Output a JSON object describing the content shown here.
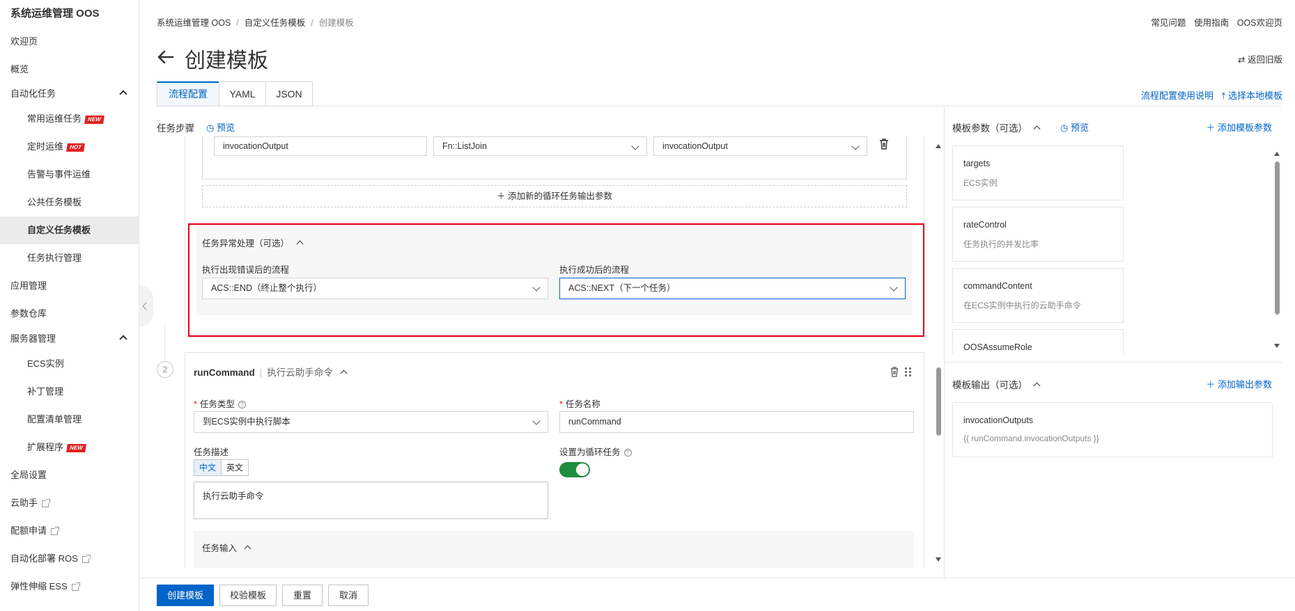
{
  "sidebar": {
    "title": "系统运维管理 OOS",
    "items": [
      {
        "label": "欢迎页"
      },
      {
        "label": "概览"
      },
      {
        "label": "自动化任务"
      },
      {
        "label": "常用运维任务",
        "badge": "NEW"
      },
      {
        "label": "定时运维",
        "badge": "HOT"
      },
      {
        "label": "告警与事件运维"
      },
      {
        "label": "公共任务模板"
      },
      {
        "label": "自定义任务模板"
      },
      {
        "label": "任务执行管理"
      },
      {
        "label": "应用管理"
      },
      {
        "label": "参数仓库"
      },
      {
        "label": "服务器管理"
      },
      {
        "label": "ECS实例"
      },
      {
        "label": "补丁管理"
      },
      {
        "label": "配置清单管理"
      },
      {
        "label": "扩展程序",
        "badge": "NEW"
      },
      {
        "label": "全局设置"
      },
      {
        "label": "云助手"
      },
      {
        "label": "配额申请"
      },
      {
        "label": "自动化部署 ROS"
      },
      {
        "label": "弹性伸缩 ESS"
      }
    ]
  },
  "breadcrumb": [
    "系统运维管理 OOS",
    "自定义任务模板",
    "创建模板"
  ],
  "top_links": [
    "常见问题",
    "使用指南",
    "OOS欢迎页"
  ],
  "page": {
    "title": "创建模板",
    "back_old": "返回旧版"
  },
  "tabs": [
    "流程配置",
    "YAML",
    "JSON"
  ],
  "tab_links": {
    "help": "流程配置使用说明",
    "local": "选择本地模板"
  },
  "steps": {
    "label": "任务步骤",
    "preview": "预览",
    "loop_output": {
      "output_name": "invocationOutput",
      "aggregator": "Fn::ListJoin",
      "source": "invocationOutput",
      "add_label": "添加新的循环任务输出参数"
    },
    "exception": {
      "title": "任务异常处理（可选）",
      "on_error_label": "执行出现错误后的流程",
      "on_error_value": "ACS::END（终止整个执行）",
      "on_success_label": "执行成功后的流程",
      "on_success_value": "ACS::NEXT（下一个任务）"
    },
    "step2": {
      "number": "2",
      "name": "runCommand",
      "desc": "执行云助手命令",
      "type_label": "任务类型",
      "type_value": "到ECS实例中执行脚本",
      "name_label": "任务名称",
      "name_value": "runCommand",
      "desc_label": "任务描述",
      "lang_zh": "中文",
      "lang_en": "英文",
      "desc_value": "执行云助手命令",
      "loop_label": "设置为循环任务",
      "loop_on": true,
      "input_label": "任务输入"
    }
  },
  "params": {
    "title": "模板参数（可选）",
    "preview": "预览",
    "add": "添加模板参数",
    "items": [
      {
        "key": "targets",
        "desc": "ECS实例"
      },
      {
        "key": "rateControl",
        "desc": "任务执行的并发比率"
      },
      {
        "key": "commandContent",
        "desc": "在ECS实例中执行的云助手命令"
      },
      {
        "key": "OOSAssumeRole",
        "desc": ""
      }
    ]
  },
  "outputs": {
    "title": "模板输出（可选）",
    "add": "添加输出参数",
    "items": [
      {
        "key": "invocationOutputs",
        "value": "{{ runCommand.invocationOutputs }}"
      }
    ]
  },
  "footer": {
    "create": "创建模板",
    "validate": "校验模板",
    "reset": "重置",
    "cancel": "取消"
  },
  "colors": {
    "primary": "#0064c8",
    "highlight": "#e60012",
    "toggle_on": "#1e8e3e",
    "tag_red": "#e02020"
  }
}
